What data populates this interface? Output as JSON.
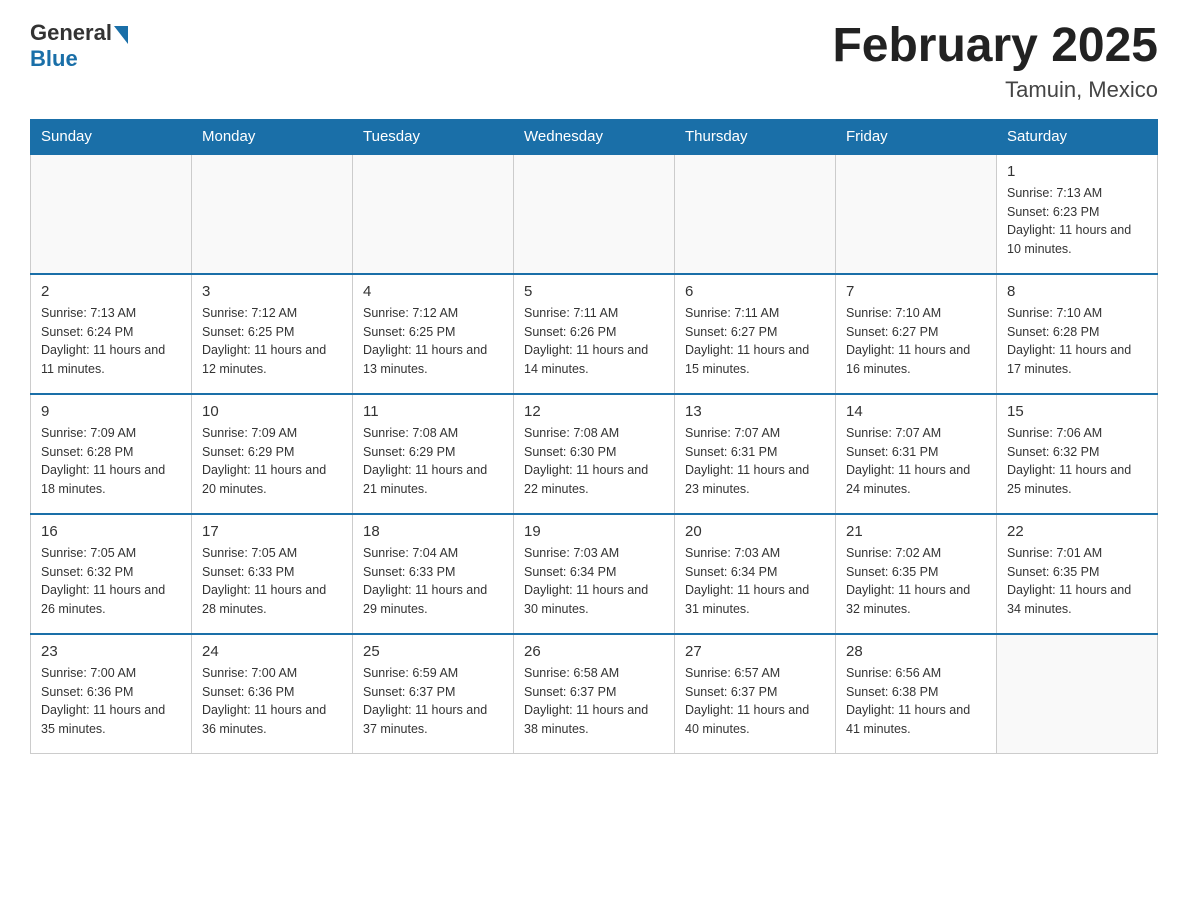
{
  "logo": {
    "general": "General",
    "blue": "Blue"
  },
  "title": "February 2025",
  "location": "Tamuin, Mexico",
  "days_of_week": [
    "Sunday",
    "Monday",
    "Tuesday",
    "Wednesday",
    "Thursday",
    "Friday",
    "Saturday"
  ],
  "weeks": [
    [
      {
        "day": "",
        "info": ""
      },
      {
        "day": "",
        "info": ""
      },
      {
        "day": "",
        "info": ""
      },
      {
        "day": "",
        "info": ""
      },
      {
        "day": "",
        "info": ""
      },
      {
        "day": "",
        "info": ""
      },
      {
        "day": "1",
        "info": "Sunrise: 7:13 AM\nSunset: 6:23 PM\nDaylight: 11 hours and 10 minutes."
      }
    ],
    [
      {
        "day": "2",
        "info": "Sunrise: 7:13 AM\nSunset: 6:24 PM\nDaylight: 11 hours and 11 minutes."
      },
      {
        "day": "3",
        "info": "Sunrise: 7:12 AM\nSunset: 6:25 PM\nDaylight: 11 hours and 12 minutes."
      },
      {
        "day": "4",
        "info": "Sunrise: 7:12 AM\nSunset: 6:25 PM\nDaylight: 11 hours and 13 minutes."
      },
      {
        "day": "5",
        "info": "Sunrise: 7:11 AM\nSunset: 6:26 PM\nDaylight: 11 hours and 14 minutes."
      },
      {
        "day": "6",
        "info": "Sunrise: 7:11 AM\nSunset: 6:27 PM\nDaylight: 11 hours and 15 minutes."
      },
      {
        "day": "7",
        "info": "Sunrise: 7:10 AM\nSunset: 6:27 PM\nDaylight: 11 hours and 16 minutes."
      },
      {
        "day": "8",
        "info": "Sunrise: 7:10 AM\nSunset: 6:28 PM\nDaylight: 11 hours and 17 minutes."
      }
    ],
    [
      {
        "day": "9",
        "info": "Sunrise: 7:09 AM\nSunset: 6:28 PM\nDaylight: 11 hours and 18 minutes."
      },
      {
        "day": "10",
        "info": "Sunrise: 7:09 AM\nSunset: 6:29 PM\nDaylight: 11 hours and 20 minutes."
      },
      {
        "day": "11",
        "info": "Sunrise: 7:08 AM\nSunset: 6:29 PM\nDaylight: 11 hours and 21 minutes."
      },
      {
        "day": "12",
        "info": "Sunrise: 7:08 AM\nSunset: 6:30 PM\nDaylight: 11 hours and 22 minutes."
      },
      {
        "day": "13",
        "info": "Sunrise: 7:07 AM\nSunset: 6:31 PM\nDaylight: 11 hours and 23 minutes."
      },
      {
        "day": "14",
        "info": "Sunrise: 7:07 AM\nSunset: 6:31 PM\nDaylight: 11 hours and 24 minutes."
      },
      {
        "day": "15",
        "info": "Sunrise: 7:06 AM\nSunset: 6:32 PM\nDaylight: 11 hours and 25 minutes."
      }
    ],
    [
      {
        "day": "16",
        "info": "Sunrise: 7:05 AM\nSunset: 6:32 PM\nDaylight: 11 hours and 26 minutes."
      },
      {
        "day": "17",
        "info": "Sunrise: 7:05 AM\nSunset: 6:33 PM\nDaylight: 11 hours and 28 minutes."
      },
      {
        "day": "18",
        "info": "Sunrise: 7:04 AM\nSunset: 6:33 PM\nDaylight: 11 hours and 29 minutes."
      },
      {
        "day": "19",
        "info": "Sunrise: 7:03 AM\nSunset: 6:34 PM\nDaylight: 11 hours and 30 minutes."
      },
      {
        "day": "20",
        "info": "Sunrise: 7:03 AM\nSunset: 6:34 PM\nDaylight: 11 hours and 31 minutes."
      },
      {
        "day": "21",
        "info": "Sunrise: 7:02 AM\nSunset: 6:35 PM\nDaylight: 11 hours and 32 minutes."
      },
      {
        "day": "22",
        "info": "Sunrise: 7:01 AM\nSunset: 6:35 PM\nDaylight: 11 hours and 34 minutes."
      }
    ],
    [
      {
        "day": "23",
        "info": "Sunrise: 7:00 AM\nSunset: 6:36 PM\nDaylight: 11 hours and 35 minutes."
      },
      {
        "day": "24",
        "info": "Sunrise: 7:00 AM\nSunset: 6:36 PM\nDaylight: 11 hours and 36 minutes."
      },
      {
        "day": "25",
        "info": "Sunrise: 6:59 AM\nSunset: 6:37 PM\nDaylight: 11 hours and 37 minutes."
      },
      {
        "day": "26",
        "info": "Sunrise: 6:58 AM\nSunset: 6:37 PM\nDaylight: 11 hours and 38 minutes."
      },
      {
        "day": "27",
        "info": "Sunrise: 6:57 AM\nSunset: 6:37 PM\nDaylight: 11 hours and 40 minutes."
      },
      {
        "day": "28",
        "info": "Sunrise: 6:56 AM\nSunset: 6:38 PM\nDaylight: 11 hours and 41 minutes."
      },
      {
        "day": "",
        "info": ""
      }
    ]
  ]
}
